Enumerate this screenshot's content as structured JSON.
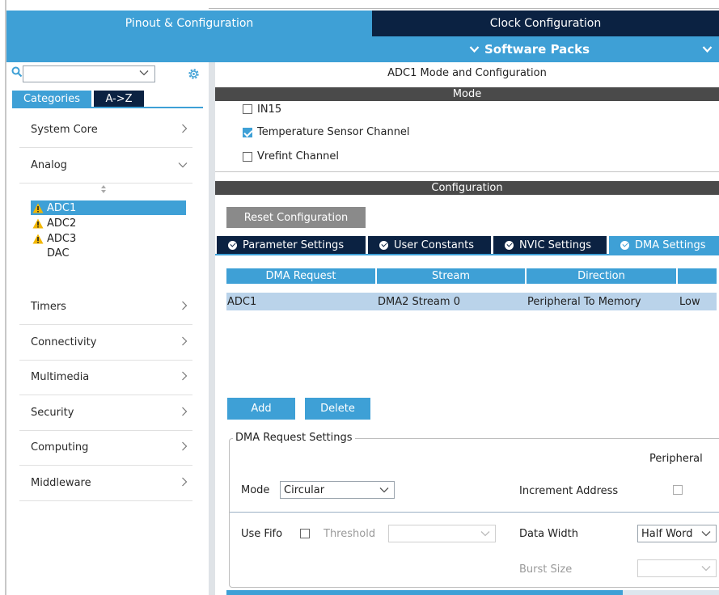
{
  "tabs": {
    "pinout": "Pinout & Configuration",
    "clock": "Clock Configuration"
  },
  "software_packs": "Software Packs",
  "sidebar": {
    "search_placeholder": "",
    "tab_categories": "Categories",
    "tab_az": "A->Z",
    "categories": [
      {
        "label": "System Core"
      },
      {
        "label": "Analog"
      },
      {
        "label": "Timers"
      },
      {
        "label": "Connectivity"
      },
      {
        "label": "Multimedia"
      },
      {
        "label": "Security"
      },
      {
        "label": "Computing"
      },
      {
        "label": "Middleware"
      }
    ],
    "analog_items": [
      {
        "label": "ADC1",
        "warning": true,
        "selected": true
      },
      {
        "label": "ADC2",
        "warning": true,
        "selected": false
      },
      {
        "label": "ADC3",
        "warning": true,
        "selected": false
      },
      {
        "label": "DAC",
        "warning": false,
        "selected": false
      }
    ]
  },
  "main": {
    "title": "ADC1 Mode and Configuration",
    "mode_header": "Mode",
    "mode_items": [
      {
        "label": "IN15",
        "checked": false
      },
      {
        "label": "Temperature Sensor Channel",
        "checked": true
      },
      {
        "label": "Vrefint Channel",
        "checked": false
      }
    ],
    "config_header": "Configuration",
    "reset_label": "Reset Configuration",
    "param_tabs": [
      {
        "label": "Parameter Settings",
        "active": false
      },
      {
        "label": "User Constants",
        "active": false
      },
      {
        "label": "NVIC Settings",
        "active": false
      },
      {
        "label": "DMA Settings",
        "active": true
      }
    ],
    "dma_table": {
      "columns": [
        "DMA Request",
        "Stream",
        "Direction",
        ""
      ],
      "rows": [
        [
          "ADC1",
          "DMA2 Stream 0",
          "Peripheral To Memory",
          "Low"
        ]
      ]
    },
    "add_label": "Add",
    "delete_label": "Delete",
    "dma_settings": {
      "legend": "DMA Request Settings",
      "peripheral_header": "Peripheral",
      "mode_label": "Mode",
      "mode_value": "Circular",
      "increment_label": "Increment Address",
      "use_fifo_label": "Use Fifo",
      "threshold_label": "Threshold",
      "data_width_label": "Data Width",
      "data_width_value": "Half Word",
      "burst_size_label": "Burst Size"
    }
  },
  "colors": {
    "accent": "#3ea0d6",
    "dark": "#0b2242",
    "header_gray": "#4a4a4a",
    "row_sel": "#bad3ea",
    "warning": "#f2b600"
  }
}
